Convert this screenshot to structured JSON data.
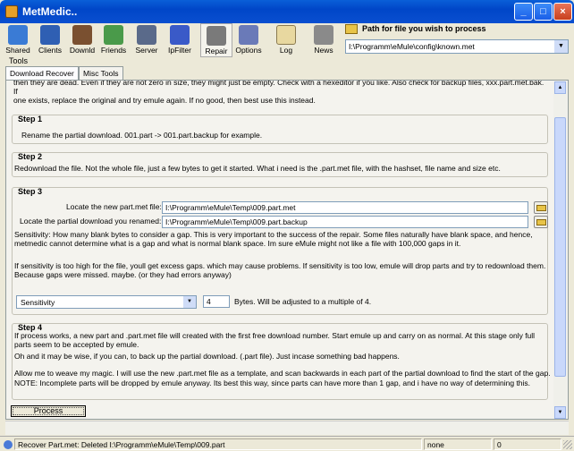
{
  "window": {
    "title": "MetMedic.."
  },
  "toolbar": {
    "buttons": [
      {
        "label": "Shared",
        "icon": "shared-icon",
        "color": "#3a7bd5"
      },
      {
        "label": "Clients",
        "icon": "clients-icon",
        "color": "#2f5fb3"
      },
      {
        "label": "Downld",
        "icon": "download-icon",
        "color": "#7a5030"
      },
      {
        "label": "Friends",
        "icon": "friends-icon",
        "color": "#4a9a4a"
      },
      {
        "label": "Server",
        "icon": "server-icon",
        "color": "#5a6a8a"
      },
      {
        "label": "IpFilter",
        "icon": "ipfilter-icon",
        "color": "#3a5ac8"
      },
      {
        "label": "Repair",
        "icon": "repair-icon",
        "color": "#7a7a7a"
      },
      {
        "label": "Options",
        "icon": "options-icon",
        "color": "#6a7ab8"
      },
      {
        "label": "Log",
        "icon": "log-icon",
        "color": "#e8d8a0"
      },
      {
        "label": "News",
        "icon": "news-icon",
        "color": "#8a8a8a"
      }
    ],
    "path_label": "Path for file you wish to process",
    "path_value": "I:\\Programm\\eMule\\config\\known.met"
  },
  "tools_label": "Tools",
  "tabs": [
    {
      "label": "Download Recover"
    },
    {
      "label": "Misc Tools"
    }
  ],
  "intro_lines": [
    "then they are dead. Even if they are not zero in size, they might just be empty. Check with a hexeditor if you like. Also check for backup files, xxx.part.met.bak. If",
    "one exists, replace the original and try emule again. If no good, then best use this instead."
  ],
  "step1": {
    "heading": "Step 1",
    "text": "Rename the partial download. 001.part -> 001.part.backup for example."
  },
  "step2": {
    "heading": "Step 2",
    "text": "Redownload the file. Not the whole file, just a few bytes to get it started. What i need is the .part.met file, with the hashset, file name and size etc."
  },
  "step3": {
    "heading": "Step 3",
    "locate_met_label": "Locate the new part.met file:",
    "locate_met_value": "I:\\Programm\\eMule\\Temp\\009.part.met",
    "locate_part_label": "Locate the partial download you renamed:",
    "locate_part_value": "I:\\Programm\\eMule\\Temp\\009.part.backup",
    "sensitivity_lines": [
      "Sensitivity: How many blank bytes to consider a gap. This is very important to the success of the repair. Some files naturally have blank space, and hence,",
      "metmedic cannot determine what is a gap and what is normal blank space. Im sure eMule might not like a file with 100,000 gaps in it."
    ],
    "excess_lines": [
      "If sensitivity is too high for the file, youll get excess gaps. which may cause problems. If sensitivity is too low, emule will drop parts and try to redownload them.",
      "Because gaps were missed. maybe. (or they had errors anyway)"
    ],
    "sensitivity_select": "Sensitivity",
    "sensitivity_value": "4",
    "bytes_text": "Bytes. Will be adjusted to a multiple of 4."
  },
  "step4": {
    "heading": "Step 4",
    "lines_a": [
      "If process works, a new part and .part.met file will created with the first free download number. Start emule up and carry on as normal. At this stage only full",
      "parts seem to be accepted by emule."
    ],
    "line_b": "Oh and it may be wise, if you can, to back up the partial download. (.part file). Just incase something bad happens.",
    "lines_c": [
      "Allow me to weave my magic. I will use the new .part.met file as a template, and scan backwards in each part of the partial download to find the start of the gap.",
      "NOTE: Incomplete parts will be dropped by emule anyway. Its best this way, since parts can have more than 1 gap, and i have no way of determining this."
    ]
  },
  "process_label": "Process",
  "status": {
    "message": "Recover Part.met: Deleted I:\\Programm\\eMule\\Temp\\009.part",
    "state": "none",
    "count": "0"
  }
}
